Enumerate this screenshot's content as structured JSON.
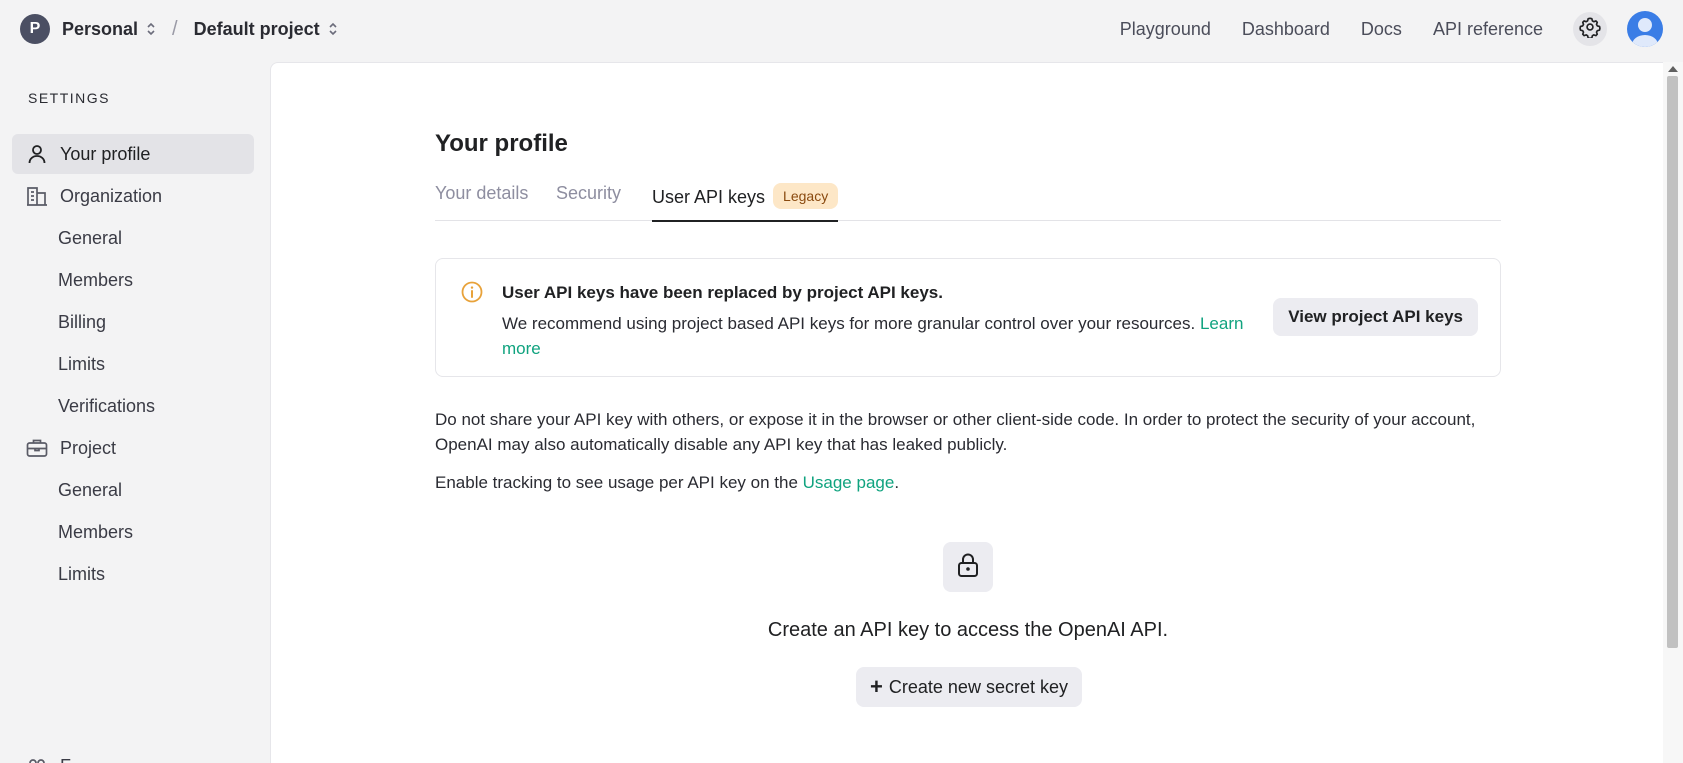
{
  "topbar": {
    "org_initial": "P",
    "org_name": "Personal",
    "separator": "/",
    "project_name": "Default project",
    "nav": [
      "Playground",
      "Dashboard",
      "Docs",
      "API reference"
    ]
  },
  "sidebar": {
    "heading": "SETTINGS",
    "items": [
      {
        "label": "Your profile",
        "icon": "person-icon",
        "active": true
      },
      {
        "label": "Organization",
        "icon": "building-icon"
      },
      {
        "label": "General"
      },
      {
        "label": "Members"
      },
      {
        "label": "Billing"
      },
      {
        "label": "Limits"
      },
      {
        "label": "Verifications"
      },
      {
        "label": "Project",
        "icon": "briefcase-icon"
      },
      {
        "label": "General"
      },
      {
        "label": "Members"
      },
      {
        "label": "Limits"
      }
    ],
    "partial_item": "F"
  },
  "main": {
    "title": "Your profile",
    "tabs": [
      {
        "label": "Your details"
      },
      {
        "label": "Security"
      },
      {
        "label": "User API keys",
        "active": true,
        "badge": "Legacy"
      }
    ],
    "notice": {
      "title": "User API keys have been replaced by project API keys.",
      "body": "We recommend using project based API keys for more granular control over your resources.",
      "link_line1": "Learn",
      "link_line2": "more",
      "button": "View project API keys"
    },
    "para1_line1": "Do not share your API key with others, or expose it in the browser or other client-side code. In order to protect the security of your account,",
    "para1_line2": "OpenAI may also automatically disable any API key that has leaked publicly.",
    "para2_prefix": "Enable tracking to see usage per API key on the ",
    "para2_link": "Usage page",
    "para2_suffix": ".",
    "empty_state": "Create an API key to access the OpenAI API.",
    "create_button": "Create new secret key",
    "create_plus": "+"
  },
  "colors": {
    "accent_link": "#10a37f",
    "badge_bg": "#fde7c7",
    "info_icon": "#e8a23a"
  }
}
